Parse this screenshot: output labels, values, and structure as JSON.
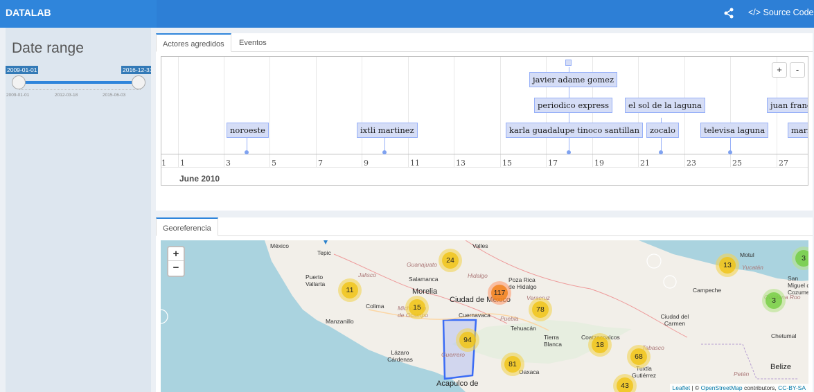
{
  "app": {
    "title": "DATALAB",
    "source_code": "</> Source Code"
  },
  "sidebar": {
    "title": "Date range",
    "slider": {
      "from": "2009-01-01",
      "to": "2016-12-31",
      "tick_labels": [
        "2009-01-01",
        "2012-03-18",
        "2015-06-03"
      ]
    }
  },
  "timeline_box": {
    "tabs": [
      {
        "label": "Actores agredidos"
      },
      {
        "label": "Eventos"
      }
    ],
    "zoom_in": "+",
    "zoom_out": "-",
    "month_label": "June 2010",
    "day_ticks": [
      "1",
      "1",
      "3",
      "5",
      "7",
      "9",
      "11",
      "13",
      "15",
      "17",
      "19",
      "21",
      "23",
      "25",
      "27"
    ],
    "items": [
      {
        "label": "noroeste"
      },
      {
        "label": "ixtli martinez"
      },
      {
        "label": "javier adame gomez"
      },
      {
        "label": "periodico express"
      },
      {
        "label": "karla guadalupe tinoco santillan"
      },
      {
        "label": "el sol de la laguna"
      },
      {
        "label": "zocalo"
      },
      {
        "label": "televisa laguna"
      },
      {
        "label": "juan franc"
      },
      {
        "label": "mari"
      }
    ]
  },
  "geo_box": {
    "tabs": [
      {
        "label": "Georeferencia"
      }
    ],
    "map": {
      "zoom_in": "+",
      "zoom_out": "−",
      "clusters": [
        "24",
        "11",
        "117",
        "15",
        "78",
        "94",
        "13",
        "3",
        "3",
        "18",
        "68",
        "81",
        "43"
      ],
      "places": [
        "México",
        "Tepic",
        "Valles",
        "Guanajuato",
        "Jalisco",
        "Salamanca",
        "Hidalgo",
        "Poza Rica de Hidalgo",
        "Puerto Vallarta",
        "Morelia",
        "Ciudad de México",
        "Veracruz",
        "Colima",
        "Michoacán de Ocampo",
        "Cuernavaca",
        "Puebla",
        "Manzanillo",
        "Tehuacán",
        "Tierra Blanca",
        "Coatzacoalcos",
        "Tabasco",
        "Lázaro Cárdenas",
        "Guerrero",
        "Oaxaca",
        "Tuxtla Gutiérrez",
        "Acapulco de",
        "Motul",
        "Yucatán",
        "Campeche",
        "Ciudad del Carmen",
        "Chetumal",
        "Belize",
        "San Miguel de Cozumel",
        "Petén",
        "Quintana Roo"
      ],
      "attribution": {
        "leaflet": "Leaflet",
        "sep": " | © ",
        "osm": "OpenStreetMap",
        "rest": " contributors, ",
        "license": "CC-BY-SA"
      }
    }
  }
}
